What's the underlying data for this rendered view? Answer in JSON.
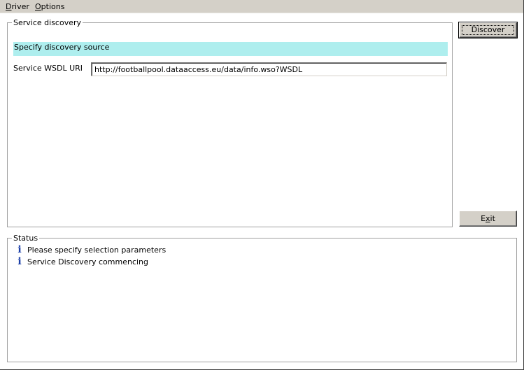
{
  "menu": {
    "items": [
      {
        "label_access": "D",
        "label_rest": "river"
      },
      {
        "label_access": "O",
        "label_rest": "ptions"
      }
    ]
  },
  "discovery": {
    "group_title": "Service discovery",
    "banner": "Specify discovery source",
    "wsdl_label": "Service WSDL URI",
    "wsdl_value": "http://footballpool.dataaccess.eu/data/info.wso?WSDL"
  },
  "buttons": {
    "discover_label": "Discover",
    "exit_pre": "E",
    "exit_access": "x",
    "exit_post": "it"
  },
  "status": {
    "group_title": "Status",
    "messages": [
      {
        "icon": "info-icon",
        "text": "Please specify selection parameters"
      },
      {
        "icon": "info-icon",
        "text": "Service Discovery commencing"
      }
    ]
  },
  "colors": {
    "banner_bg": "#aeeeee",
    "chrome": "#d4d0c8",
    "info_icon": "#1c3fa8"
  }
}
